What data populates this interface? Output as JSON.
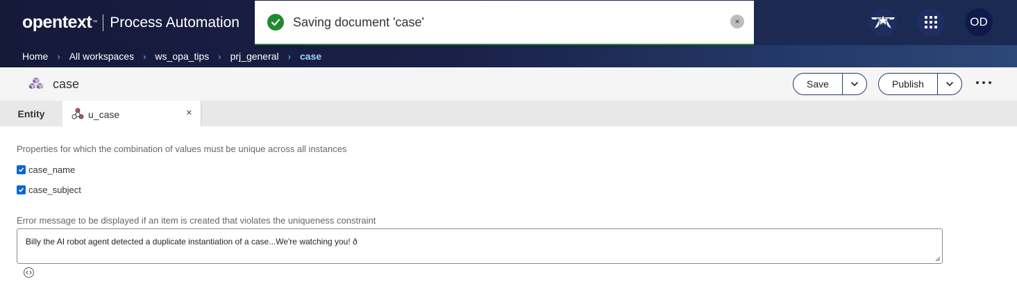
{
  "header": {
    "brand": "opentext",
    "trademark": "™",
    "product": "Process Automation",
    "avatar_initials": "OD",
    "icons": [
      "star-badge-icon",
      "apps-grid-icon"
    ]
  },
  "breadcrumb": [
    "Home",
    "All workspaces",
    "ws_opa_tips",
    "prj_general",
    "case"
  ],
  "toast": {
    "message": "Saving document 'case'",
    "close": "×"
  },
  "document": {
    "title": "case",
    "save_label": "Save",
    "publish_label": "Publish"
  },
  "tabs": {
    "entity": "Entity",
    "active": "u_case",
    "close": "×"
  },
  "content": {
    "description": "Properties for which the combination of values must be unique across all instances",
    "properties": [
      {
        "label": "case_name",
        "checked": true
      },
      {
        "label": "case_subject",
        "checked": true
      }
    ],
    "error_label": "Error message to be displayed if an item is created that violates the uniqueness constraint",
    "error_value": "Billy the AI robot agent detected a duplicate instantiation of a case...We're watching you! ð"
  },
  "colors": {
    "header_bg": "#15193a",
    "breadcrumb_active": "#9fd3ff",
    "toast_success": "#1f8a2e",
    "checkbox": "#0a66d6"
  }
}
